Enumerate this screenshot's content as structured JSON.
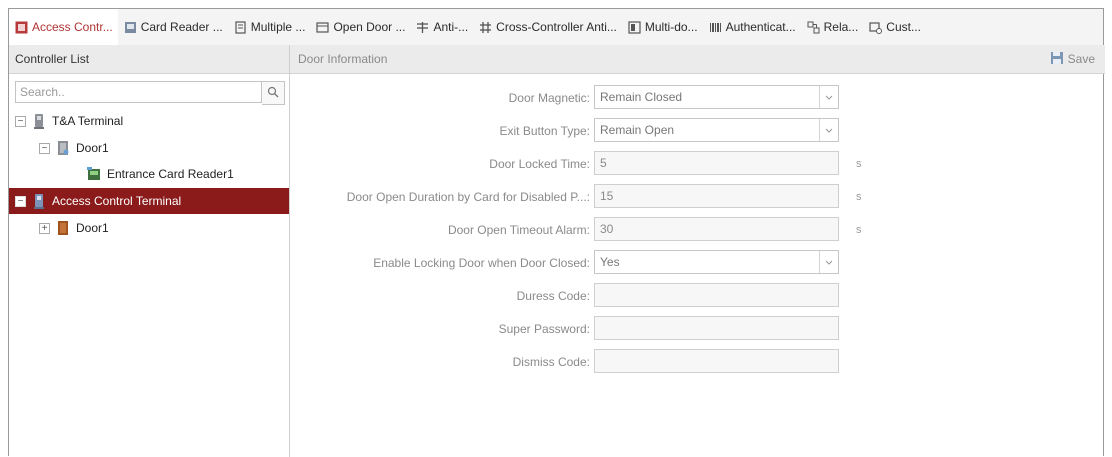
{
  "tabs": [
    {
      "label": "Access Contr...",
      "icon": "access-control-icon"
    },
    {
      "label": "Card Reader ...",
      "icon": "card-reader-icon"
    },
    {
      "label": "Multiple ...",
      "icon": "building-icon"
    },
    {
      "label": "Open Door ...",
      "icon": "calendar-icon"
    },
    {
      "label": "Anti-...",
      "icon": "anti-passback-icon"
    },
    {
      "label": "Cross-Controller Anti...",
      "icon": "cross-controller-icon"
    },
    {
      "label": "Multi-do...",
      "icon": "multi-door-icon"
    },
    {
      "label": "Authenticat...",
      "icon": "barcode-icon"
    },
    {
      "label": "Rela...",
      "icon": "relay-icon"
    },
    {
      "label": "Cust...",
      "icon": "custom-icon"
    }
  ],
  "left": {
    "header": "Controller List",
    "search": {
      "placeholder": "Search..",
      "value": ""
    },
    "tree": [
      {
        "label": "T&A Terminal",
        "expander": "−"
      },
      {
        "label": "Door1",
        "expander": "−"
      },
      {
        "label": "Entrance Card Reader1",
        "expander": ""
      },
      {
        "label": "Access Control Terminal",
        "expander": "−"
      },
      {
        "label": "Door1",
        "expander": "+"
      }
    ]
  },
  "right": {
    "header": "Door Information",
    "save_label": "Save",
    "fields": [
      {
        "label": "Door Magnetic:",
        "value": "Remain Closed",
        "unit": ""
      },
      {
        "label": "Exit Button Type:",
        "value": "Remain Open",
        "unit": ""
      },
      {
        "label": "Door Locked Time:",
        "value": "5",
        "unit": "s"
      },
      {
        "label": "Door Open Duration by Card for Disabled P...:",
        "value": "15",
        "unit": "s"
      },
      {
        "label": "Door Open Timeout Alarm:",
        "value": "30",
        "unit": "s"
      },
      {
        "label": "Enable Locking Door when Door Closed:",
        "value": "Yes",
        "unit": ""
      },
      {
        "label": "Duress Code:",
        "value": "",
        "unit": ""
      },
      {
        "label": "Super Password:",
        "value": "",
        "unit": ""
      },
      {
        "label": "Dismiss Code:",
        "value": "",
        "unit": ""
      }
    ]
  },
  "colors": {
    "selected": "#8b1a1a",
    "active_tab_text": "#b03434"
  }
}
